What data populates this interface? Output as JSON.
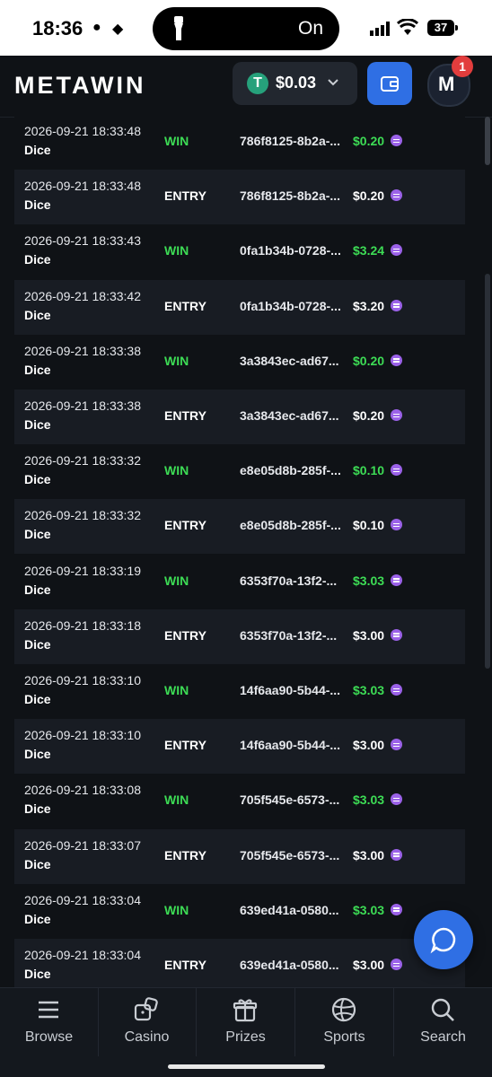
{
  "status_bar": {
    "time": "18:36",
    "dynamic_island_text": "On",
    "battery": "37"
  },
  "header": {
    "logo": "METAWIN",
    "balance": "$0.03",
    "notification_count": "1"
  },
  "rows": [
    {
      "datetime": "2026-09-21 18:33:48",
      "game": "Dice",
      "type": "WIN",
      "tx": "786f8125-8b2a-...",
      "amount": "$0.20"
    },
    {
      "datetime": "2026-09-21 18:33:48",
      "game": "Dice",
      "type": "ENTRY",
      "tx": "786f8125-8b2a-...",
      "amount": "$0.20"
    },
    {
      "datetime": "2026-09-21 18:33:43",
      "game": "Dice",
      "type": "WIN",
      "tx": "0fa1b34b-0728-...",
      "amount": "$3.24"
    },
    {
      "datetime": "2026-09-21 18:33:42",
      "game": "Dice",
      "type": "ENTRY",
      "tx": "0fa1b34b-0728-...",
      "amount": "$3.20"
    },
    {
      "datetime": "2026-09-21 18:33:38",
      "game": "Dice",
      "type": "WIN",
      "tx": "3a3843ec-ad67...",
      "amount": "$0.20"
    },
    {
      "datetime": "2026-09-21 18:33:38",
      "game": "Dice",
      "type": "ENTRY",
      "tx": "3a3843ec-ad67...",
      "amount": "$0.20"
    },
    {
      "datetime": "2026-09-21 18:33:32",
      "game": "Dice",
      "type": "WIN",
      "tx": "e8e05d8b-285f-...",
      "amount": "$0.10"
    },
    {
      "datetime": "2026-09-21 18:33:32",
      "game": "Dice",
      "type": "ENTRY",
      "tx": "e8e05d8b-285f-...",
      "amount": "$0.10"
    },
    {
      "datetime": "2026-09-21 18:33:19",
      "game": "Dice",
      "type": "WIN",
      "tx": "6353f70a-13f2-...",
      "amount": "$3.03"
    },
    {
      "datetime": "2026-09-21 18:33:18",
      "game": "Dice",
      "type": "ENTRY",
      "tx": "6353f70a-13f2-...",
      "amount": "$3.00"
    },
    {
      "datetime": "2026-09-21 18:33:10",
      "game": "Dice",
      "type": "WIN",
      "tx": "14f6aa90-5b44-...",
      "amount": "$3.03"
    },
    {
      "datetime": "2026-09-21 18:33:10",
      "game": "Dice",
      "type": "ENTRY",
      "tx": "14f6aa90-5b44-...",
      "amount": "$3.00"
    },
    {
      "datetime": "2026-09-21 18:33:08",
      "game": "Dice",
      "type": "WIN",
      "tx": "705f545e-6573-...",
      "amount": "$3.03"
    },
    {
      "datetime": "2026-09-21 18:33:07",
      "game": "Dice",
      "type": "ENTRY",
      "tx": "705f545e-6573-...",
      "amount": "$3.00"
    },
    {
      "datetime": "2026-09-21 18:33:04",
      "game": "Dice",
      "type": "WIN",
      "tx": "639ed41a-0580...",
      "amount": "$3.03"
    },
    {
      "datetime": "2026-09-21 18:33:04",
      "game": "Dice",
      "type": "ENTRY",
      "tx": "639ed41a-0580...",
      "amount": "$3.00"
    }
  ],
  "nav": [
    {
      "label": "Browse",
      "icon": "menu-icon"
    },
    {
      "label": "Casino",
      "icon": "dice-icon"
    },
    {
      "label": "Prizes",
      "icon": "gift-icon"
    },
    {
      "label": "Sports",
      "icon": "ball-icon"
    },
    {
      "label": "Search",
      "icon": "search-icon"
    }
  ],
  "colors": {
    "win": "#3ddc55",
    "accent": "#2f6fe4",
    "coin": "#9b62e8"
  }
}
